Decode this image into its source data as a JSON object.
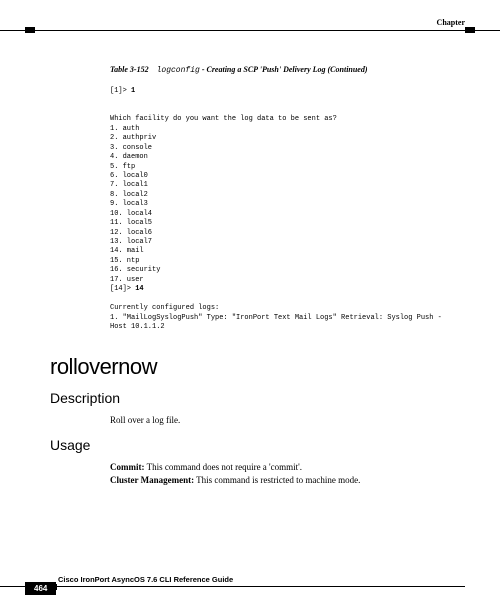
{
  "header": {
    "chapter": "Chapter"
  },
  "table_caption": {
    "label": "Table 3-152",
    "cmd": "logconfig",
    "rest": " - Creating a SCP 'Push' Delivery Log  (Continued)"
  },
  "code": {
    "prompt1": "[1]> ",
    "prompt1_val": "1",
    "blank1": "",
    "question": "Which facility do you want the log data to be sent as?",
    "opt1": "1. auth",
    "opt2": "2. authpriv",
    "opt3": "3. console",
    "opt4": "4. daemon",
    "opt5": "5. ftp",
    "opt6": "6. local0",
    "opt7": "7. local1",
    "opt8": "8. local2",
    "opt9": "9. local3",
    "opt10": "10. local4",
    "opt11": "11. local5",
    "opt12": "12. local6",
    "opt13": "13. local7",
    "opt14": "14. mail",
    "opt15": "15. ntp",
    "opt16": "16. security",
    "opt17": "17. user",
    "prompt2": "[14]> ",
    "prompt2_val": "14",
    "blank2": "",
    "configured": "Currently configured logs:",
    "log1": "1. \"MailLogSyslogPush\" Type: \"IronPort Text Mail Logs\" Retrieval: Syslog Push -",
    "log2": "Host 10.1.1.2"
  },
  "sections": {
    "cmd_name": "rollovernow",
    "description_h": "Description",
    "description_body": "Roll over a log file.",
    "usage_h": "Usage",
    "commit_label": "Commit:",
    "commit_text": " This command does not require a 'commit'.",
    "cluster_label": "Cluster Management:",
    "cluster_text": " This command is restricted to machine mode."
  },
  "footer": {
    "doc_title": "Cisco IronPort AsyncOS 7.6 CLI Reference Guide",
    "page_num": "464"
  }
}
